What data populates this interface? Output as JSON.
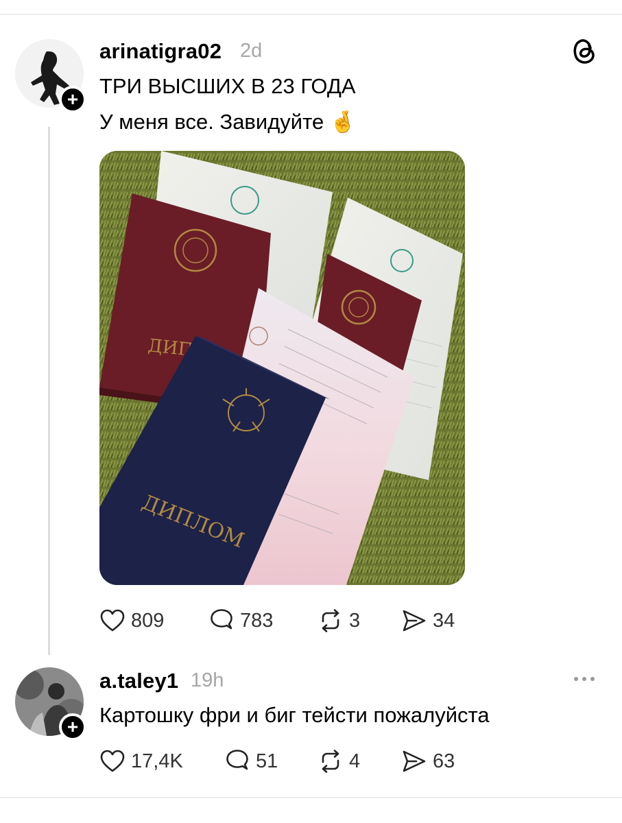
{
  "post": {
    "username": "arinatigra02",
    "time": "2d",
    "line1": "ТРИ ВЫСШИХ В 23 ГОДА",
    "line2": "У меня все. Завидуйте",
    "line2_emoji": "🤞",
    "image": {
      "diploma_text": "ДИПЛОМ",
      "diploma_text_partial": "ДИПЛО"
    },
    "actions": {
      "likes": "809",
      "replies": "783",
      "reposts": "3",
      "shares": "34"
    }
  },
  "reply": {
    "username": "a.taley1",
    "time": "19h",
    "text": "Картошку фри и биг тейсти пожалуйста",
    "actions": {
      "likes": "17,4K",
      "replies": "51",
      "reposts": "4",
      "shares": "63"
    }
  },
  "icons": {
    "app": "threads-icon",
    "follow": "plus-icon",
    "like": "heart-icon",
    "reply": "comment-icon",
    "repost": "repost-icon",
    "share": "send-icon",
    "more": "more-icon"
  }
}
